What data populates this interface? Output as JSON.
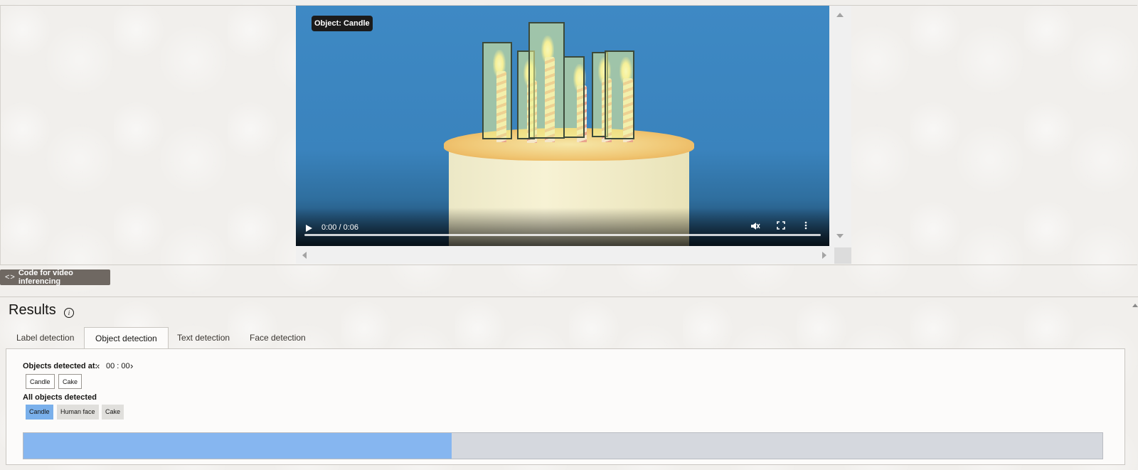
{
  "video": {
    "overlay_label": "Object: Candle",
    "time": "0:00 / 0:06",
    "progress": 0
  },
  "code_button": {
    "icon": "code-icon",
    "label": "Code for video inferencing"
  },
  "results": {
    "title": "Results",
    "info_icon": "i",
    "tabs": [
      {
        "label": "Label detection"
      },
      {
        "label": "Object detection",
        "active": true
      },
      {
        "label": "Text detection"
      },
      {
        "label": "Face detection"
      }
    ],
    "objects_at_label": "Objects detected at:",
    "timestamp": "00 : 00",
    "objects_at": [
      "Candle",
      "Cake"
    ],
    "all_objects_label": "All objects detected",
    "all_objects": [
      {
        "label": "Candle",
        "selected": true
      },
      {
        "label": "Human face",
        "selected": false
      },
      {
        "label": "Cake",
        "selected": false
      }
    ],
    "timeline_fraction": 0.397
  },
  "colors": {
    "accent": "#86b6f0",
    "selected_chip": "#7ab0eb",
    "button_bg": "#6f6862"
  }
}
